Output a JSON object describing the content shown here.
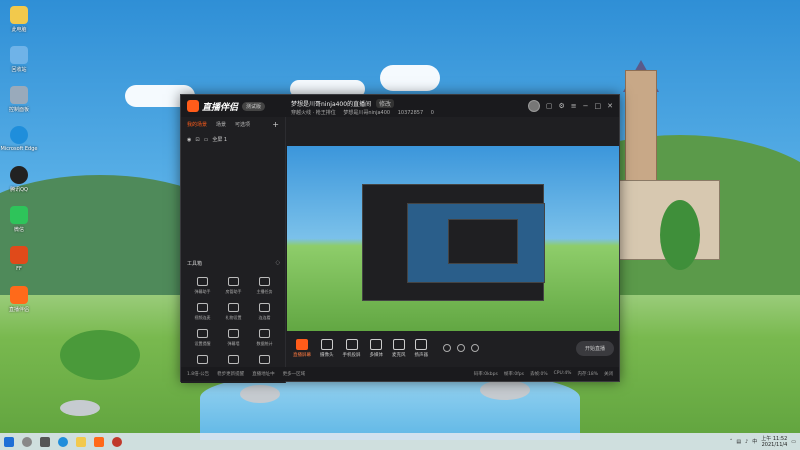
{
  "desktop": {
    "icons": [
      {
        "label": "此电脑",
        "color": "#f2c94c"
      },
      {
        "label": "回收站",
        "color": "#6fb3e8"
      },
      {
        "label": "控制面板",
        "color": "#9ab"
      },
      {
        "label": "Microsoft Edge",
        "color": "#1f8edb"
      },
      {
        "label": "腾讯QQ",
        "color": "#222"
      },
      {
        "label": "微信",
        "color": "#2ec45a"
      },
      {
        "label": "FF",
        "color": "#e04a1a"
      },
      {
        "label": "直播伴侣",
        "color": "#ff6a1a"
      }
    ]
  },
  "app": {
    "logo_text": "直播伴侣",
    "version": "测试版",
    "room_title": "梦想是川哥ninja400的直播间",
    "room_tag": "修改",
    "room_sub": [
      "穿越火线 · 枪王排位",
      "梦想是川哥ninja400",
      "10372857",
      "0"
    ],
    "tabs": [
      "我的场景",
      "场景",
      "可选项"
    ],
    "active_tab": "我的场景",
    "scene_label": "全屏 1",
    "tools_title": "工具箱",
    "tools": [
      "弹幕助手",
      "房管助手",
      "主播任务",
      "视频连麦",
      "礼物设置",
      "连连看",
      "设置提醒",
      "弹幕墙",
      "数据统计",
      "福利",
      "下载",
      "更多"
    ],
    "bottom_buttons": [
      "直播屏幕",
      "摄像头",
      "手机投屏",
      "多媒体",
      "麦克风",
      "扬声器"
    ],
    "live_button": "直播屏幕",
    "start_button": "开始直播",
    "status_left": [
      "1.8倍·公告",
      "稳步更新提醒",
      "直播地址中",
      "更多一区域"
    ],
    "status_right": [
      "码率:0kbps",
      "帧率:0fps",
      "丢帧:0%",
      "CPU:4%",
      "内存:18%",
      "关闭"
    ]
  },
  "taskbar": {
    "time": "上午 11:52",
    "date": "2021/11/4"
  }
}
